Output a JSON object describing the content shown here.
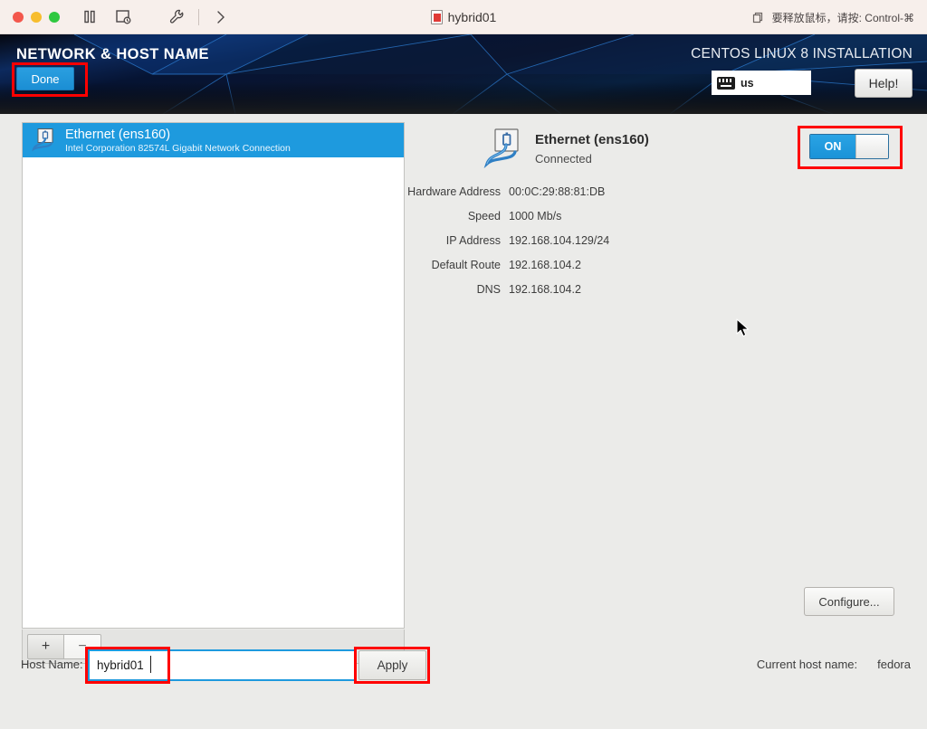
{
  "window": {
    "title": "hybrid01",
    "release_hint": "要释放鼠标，请按: Control-⌘"
  },
  "banner": {
    "screen_title": "NETWORK & HOST NAME",
    "done_label": "Done",
    "product_title": "CENTOS LINUX 8 INSTALLATION",
    "keyboard_layout": "us",
    "help_label": "Help!"
  },
  "network_list": {
    "items": [
      {
        "name": "Ethernet (ens160)",
        "description": "Intel Corporation 82574L Gigabit Network Connection",
        "selected": true
      }
    ],
    "add_label": "+",
    "remove_label": "−"
  },
  "detail": {
    "title": "Ethernet (ens160)",
    "status": "Connected",
    "toggle_label": "ON",
    "rows": [
      {
        "label": "Hardware Address",
        "value": "00:0C:29:88:81:DB"
      },
      {
        "label": "Speed",
        "value": "1000 Mb/s"
      },
      {
        "label": "IP Address",
        "value": "192.168.104.129/24"
      },
      {
        "label": "Default Route",
        "value": "192.168.104.2"
      },
      {
        "label": "DNS",
        "value": "192.168.104.2"
      }
    ],
    "configure_label": "Configure..."
  },
  "host": {
    "label": "Host Name:",
    "value": "hybrid01",
    "placeholder": "",
    "apply_label": "Apply",
    "current_label": "Current host name:",
    "current_value": "fedora"
  },
  "colors": {
    "accent_blue": "#1e9ade",
    "highlight_red": "#ff0000",
    "banner_dark": "#0a0f1e",
    "body_gray": "#ebebe9"
  }
}
